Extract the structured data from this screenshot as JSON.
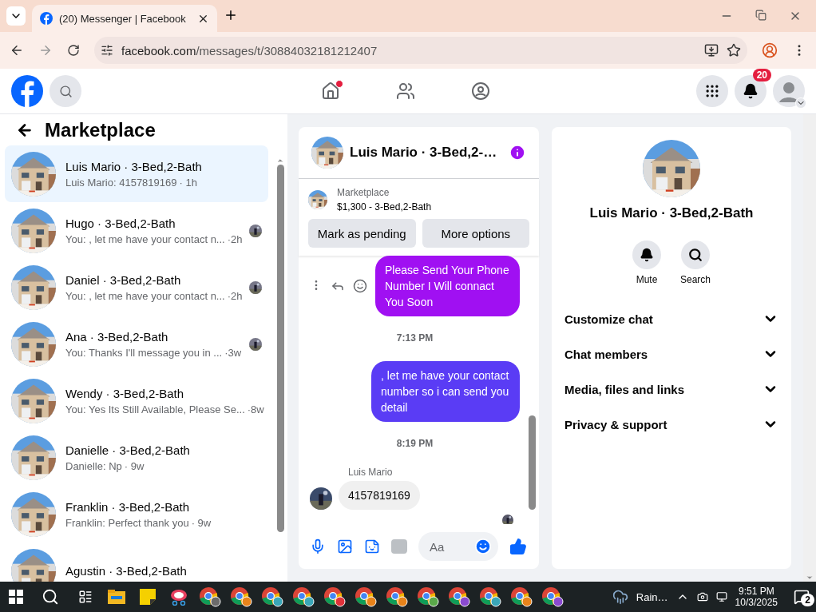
{
  "browser": {
    "tab": {
      "title": "(20) Messenger | Facebook",
      "selected": true
    },
    "url_host": "facebook.com",
    "url_path": "/messages/t/30884032181212407"
  },
  "header": {
    "home_dot": true,
    "notification_count": "20"
  },
  "sidebar": {
    "title": "Marketplace",
    "conversations": [
      {
        "name": "Luis Mario · 3-Bed,2-Bath",
        "preview": "Luis Mario: 4157819169",
        "time": "· 1h",
        "selected": true,
        "seen": false
      },
      {
        "name": "Hugo · 3-Bed,2-Bath",
        "preview": "You: , let me have your contact n...",
        "time": "·2h",
        "selected": false,
        "seen": true
      },
      {
        "name": "Daniel · 3-Bed,2-Bath",
        "preview": "You: , let me have your contact n...",
        "time": "·2h",
        "selected": false,
        "seen": true
      },
      {
        "name": "Ana · 3-Bed,2-Bath",
        "preview": "You: Thanks I'll message you in ...",
        "time": "·3w",
        "selected": false,
        "seen": true
      },
      {
        "name": "Wendy · 3-Bed,2-Bath",
        "preview": "You: Yes Its Still Available, Please Se...",
        "time": "·8w",
        "selected": false,
        "seen": false
      },
      {
        "name": "Danielle · 3-Bed,2-Bath",
        "preview": "Danielle: Np",
        "time": "· 9w",
        "selected": false,
        "seen": false
      },
      {
        "name": "Franklin · 3-Bed,2-Bath",
        "preview": "Franklin: Perfect thank you",
        "time": "· 9w",
        "selected": false,
        "seen": false
      },
      {
        "name": "Agustin · 3-Bed,2-Bath",
        "selected": false,
        "seen": false
      }
    ]
  },
  "chat": {
    "title": "Luis Mario · 3-Bed,2-…",
    "listing": {
      "label": "Marketplace",
      "detail": "$1,300 - 3-Bed,2-Bath"
    },
    "buttons": [
      "Mark as pending",
      "More options"
    ],
    "messages": [
      {
        "kind": "outgoing",
        "text": "Please Send Your Phone Number I Will connact You Soon",
        "color": "#a010f2"
      },
      {
        "kind": "time",
        "text": "7:13 PM"
      },
      {
        "kind": "outgoing",
        "text": ", let me have your contact number so i can send you detail",
        "color": "#5a3cf5"
      },
      {
        "kind": "time",
        "text": "8:19 PM"
      },
      {
        "kind": "incoming",
        "sender": "Luis Mario",
        "text": "4157819169"
      }
    ],
    "composer": {
      "placeholder": "Aa"
    }
  },
  "details": {
    "name": "Luis Mario · 3-Bed,2-Bath",
    "actions": [
      "Mute",
      "Search"
    ],
    "sections": [
      {
        "label": "Customize chat",
        "expanded": false
      },
      {
        "label": "Chat members",
        "expanded": false
      },
      {
        "label": "Media, files and links",
        "expanded": false
      },
      {
        "label": "Privacy & support",
        "expanded": false
      }
    ]
  },
  "taskbar": {
    "apps": [
      {
        "kind": "task-view"
      },
      {
        "kind": "explorer"
      },
      {
        "kind": "notes"
      },
      {
        "kind": "snip"
      },
      {
        "kind": "chrome",
        "color": "#6b6b6b"
      },
      {
        "kind": "chrome",
        "color": "#e8831a"
      },
      {
        "kind": "chrome",
        "color": "#3aa7b8"
      },
      {
        "kind": "chrome",
        "color": "#3aa7b8"
      },
      {
        "kind": "chrome",
        "color": "#e0323a"
      },
      {
        "kind": "chrome",
        "color": "#e8831a"
      },
      {
        "kind": "chrome",
        "color": "#e8831a"
      },
      {
        "kind": "chrome",
        "color": "#5aa84a"
      },
      {
        "kind": "chrome",
        "color": "#8a4ad0"
      },
      {
        "kind": "chrome",
        "color": "#3aa7b8"
      },
      {
        "kind": "chrome",
        "color": "#e8831a"
      },
      {
        "kind": "chrome",
        "color": "#8a4ad0"
      }
    ],
    "weather": "Rain…",
    "time": "9:51 PM",
    "date": "10/3/2025",
    "notifications": "2"
  }
}
